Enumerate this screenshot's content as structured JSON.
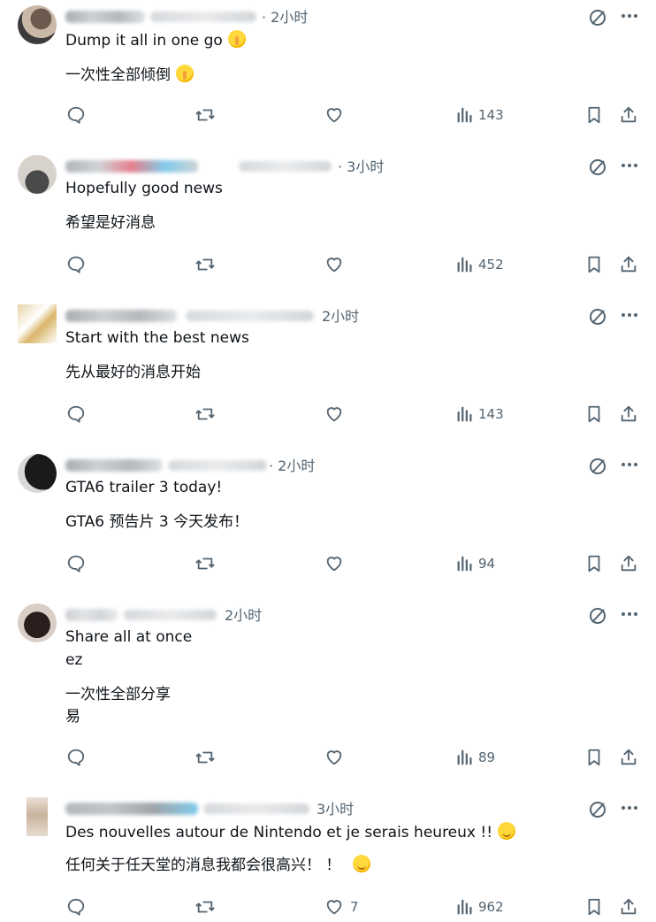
{
  "replies": [
    {
      "time": "· 2小时",
      "lines": [
        "Dump it all in one go",
        "一次性全部倾倒"
      ],
      "emoji": "shushing-face",
      "like_count": "",
      "views": "143"
    },
    {
      "time": "· 3小时",
      "lines": [
        "Hopefully good news",
        "希望是好消息"
      ],
      "emoji": "",
      "like_count": "",
      "views": "452"
    },
    {
      "time": "2小时",
      "lines": [
        "Start with the best news",
        "先从最好的消息开始"
      ],
      "emoji": "",
      "like_count": "",
      "views": "143"
    },
    {
      "time": "· 2小时",
      "lines": [
        "GTA6 trailer 3 today!",
        "GTA6 预告片 3 今天发布！"
      ],
      "emoji": "",
      "like_count": "",
      "views": "94"
    },
    {
      "time": "2小时",
      "lines": [
        "Share all at once",
        "ez",
        "一次性全部分享",
        "易"
      ],
      "emoji": "",
      "like_count": "",
      "views": "89"
    },
    {
      "time": "3小时",
      "lines": [
        "Des nouvelles autour de Nintendo et je serais heureux !!",
        "任何关于任天堂的消息我都会很高兴！ ！"
      ],
      "emoji": "smiling-face",
      "like_count": "7",
      "views": "962"
    }
  ],
  "icons": {
    "reply": "reply-icon",
    "retweet": "retweet-icon",
    "like": "like-icon",
    "views": "views-icon",
    "bookmark": "bookmark-icon",
    "share": "share-icon",
    "grok": "grok-icon",
    "more": "more-icon"
  },
  "colors": {
    "text": "#0f1419",
    "muted": "#536471",
    "background": "#ffffff"
  }
}
